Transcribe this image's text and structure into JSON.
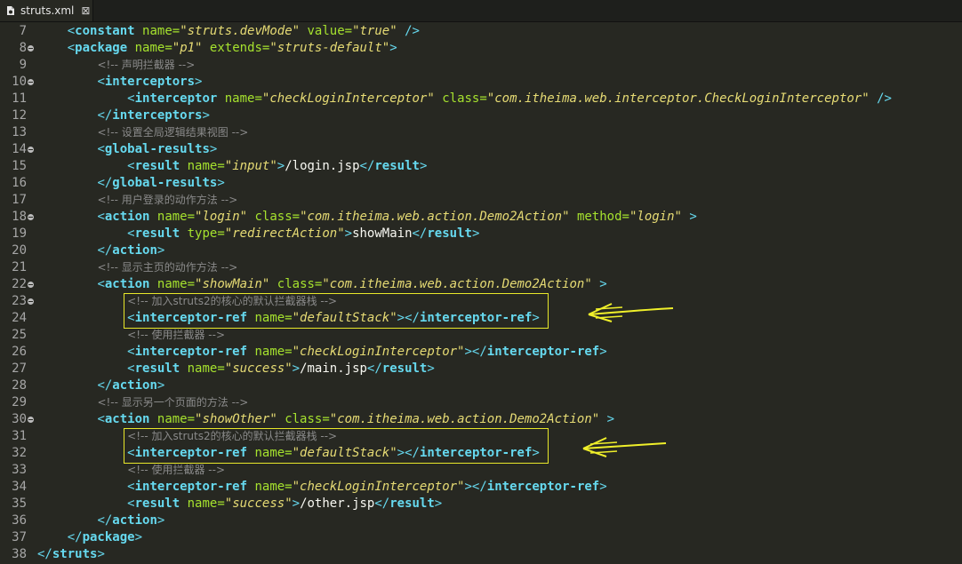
{
  "tab": {
    "title": "struts.xml",
    "close_glyph": "⊠"
  },
  "lines": [
    {
      "num": "7",
      "fold": false,
      "indent": 1,
      "tokens": [
        [
          "b",
          "<"
        ],
        [
          "t",
          "constant"
        ],
        [
          "x",
          " "
        ],
        [
          "a",
          "name="
        ],
        [
          "v",
          "\"struts.devMode\""
        ],
        [
          "x",
          " "
        ],
        [
          "a",
          "value="
        ],
        [
          "v",
          "\"true\""
        ],
        [
          "x",
          " "
        ],
        [
          "b",
          "/>"
        ]
      ]
    },
    {
      "num": "8",
      "fold": true,
      "indent": 1,
      "tokens": [
        [
          "b",
          "<"
        ],
        [
          "t",
          "package"
        ],
        [
          "x",
          " "
        ],
        [
          "a",
          "name="
        ],
        [
          "v",
          "\"p1\""
        ],
        [
          "x",
          " "
        ],
        [
          "a",
          "extends="
        ],
        [
          "v",
          "\"struts-default\""
        ],
        [
          "b",
          ">"
        ]
      ]
    },
    {
      "num": "9",
      "fold": false,
      "indent": 2,
      "tokens": [
        [
          "c",
          "<!-- 声明拦截器 -->"
        ]
      ]
    },
    {
      "num": "10",
      "fold": true,
      "indent": 2,
      "tokens": [
        [
          "b",
          "<"
        ],
        [
          "t",
          "interceptors"
        ],
        [
          "b",
          ">"
        ]
      ]
    },
    {
      "num": "11",
      "fold": false,
      "indent": 3,
      "tokens": [
        [
          "b",
          "<"
        ],
        [
          "t",
          "interceptor"
        ],
        [
          "x",
          " "
        ],
        [
          "a",
          "name="
        ],
        [
          "v",
          "\"checkLoginInterceptor\""
        ],
        [
          "x",
          " "
        ],
        [
          "a",
          "class="
        ],
        [
          "v",
          "\"com.itheima.web.interceptor.CheckLoginInterceptor\""
        ],
        [
          "x",
          " "
        ],
        [
          "b",
          "/>"
        ]
      ]
    },
    {
      "num": "12",
      "fold": false,
      "indent": 2,
      "tokens": [
        [
          "b",
          "</"
        ],
        [
          "t",
          "interceptors"
        ],
        [
          "b",
          ">"
        ]
      ]
    },
    {
      "num": "13",
      "fold": false,
      "indent": 2,
      "tokens": [
        [
          "c",
          "<!-- 设置全局逻辑结果视图 -->"
        ]
      ]
    },
    {
      "num": "14",
      "fold": true,
      "indent": 2,
      "tokens": [
        [
          "b",
          "<"
        ],
        [
          "t",
          "global-results"
        ],
        [
          "b",
          ">"
        ]
      ]
    },
    {
      "num": "15",
      "fold": false,
      "indent": 3,
      "tokens": [
        [
          "b",
          "<"
        ],
        [
          "t",
          "result"
        ],
        [
          "x",
          " "
        ],
        [
          "a",
          "name="
        ],
        [
          "v",
          "\"input\""
        ],
        [
          "b",
          ">"
        ],
        [
          "x",
          "/login.jsp"
        ],
        [
          "b",
          "</"
        ],
        [
          "t",
          "result"
        ],
        [
          "b",
          ">"
        ]
      ]
    },
    {
      "num": "16",
      "fold": false,
      "indent": 2,
      "tokens": [
        [
          "b",
          "</"
        ],
        [
          "t",
          "global-results"
        ],
        [
          "b",
          ">"
        ]
      ]
    },
    {
      "num": "17",
      "fold": false,
      "indent": 2,
      "tokens": [
        [
          "c",
          "<!-- 用户登录的动作方法 -->"
        ]
      ]
    },
    {
      "num": "18",
      "fold": true,
      "indent": 2,
      "tokens": [
        [
          "b",
          "<"
        ],
        [
          "t",
          "action"
        ],
        [
          "x",
          " "
        ],
        [
          "a",
          "name="
        ],
        [
          "v",
          "\"login\""
        ],
        [
          "x",
          " "
        ],
        [
          "a",
          "class="
        ],
        [
          "v",
          "\"com.itheima.web.action.Demo2Action\""
        ],
        [
          "x",
          " "
        ],
        [
          "a",
          "method="
        ],
        [
          "v",
          "\"login\""
        ],
        [
          "x",
          " "
        ],
        [
          "b",
          ">"
        ]
      ]
    },
    {
      "num": "19",
      "fold": false,
      "indent": 3,
      "tokens": [
        [
          "b",
          "<"
        ],
        [
          "t",
          "result"
        ],
        [
          "x",
          " "
        ],
        [
          "a",
          "type="
        ],
        [
          "v",
          "\"redirectAction\""
        ],
        [
          "b",
          ">"
        ],
        [
          "x",
          "showMain"
        ],
        [
          "b",
          "</"
        ],
        [
          "t",
          "result"
        ],
        [
          "b",
          ">"
        ]
      ]
    },
    {
      "num": "20",
      "fold": false,
      "indent": 2,
      "tokens": [
        [
          "b",
          "</"
        ],
        [
          "t",
          "action"
        ],
        [
          "b",
          ">"
        ]
      ]
    },
    {
      "num": "21",
      "fold": false,
      "indent": 2,
      "tokens": [
        [
          "c",
          "<!-- 显示主页的动作方法 -->"
        ]
      ]
    },
    {
      "num": "22",
      "fold": true,
      "indent": 2,
      "tokens": [
        [
          "b",
          "<"
        ],
        [
          "t",
          "action"
        ],
        [
          "x",
          " "
        ],
        [
          "a",
          "name="
        ],
        [
          "v",
          "\"showMain\""
        ],
        [
          "x",
          " "
        ],
        [
          "a",
          "class="
        ],
        [
          "v",
          "\"com.itheima.web.action.Demo2Action\""
        ],
        [
          "x",
          " "
        ],
        [
          "b",
          ">"
        ]
      ]
    },
    {
      "num": "23",
      "fold": true,
      "indent": 3,
      "tokens": [
        [
          "c",
          "<!-- 加入struts2的核心的默认拦截器栈 -->"
        ]
      ]
    },
    {
      "num": "24",
      "fold": false,
      "indent": 3,
      "tokens": [
        [
          "b",
          "<"
        ],
        [
          "t",
          "interceptor-ref"
        ],
        [
          "x",
          " "
        ],
        [
          "a",
          "name="
        ],
        [
          "v",
          "\"defaultStack\""
        ],
        [
          "b",
          "></"
        ],
        [
          "t",
          "interceptor-ref"
        ],
        [
          "b",
          ">"
        ]
      ]
    },
    {
      "num": "25",
      "fold": false,
      "indent": 3,
      "tokens": [
        [
          "c",
          "<!-- 使用拦截器 -->"
        ]
      ]
    },
    {
      "num": "26",
      "fold": false,
      "indent": 3,
      "tokens": [
        [
          "b",
          "<"
        ],
        [
          "t",
          "interceptor-ref"
        ],
        [
          "x",
          " "
        ],
        [
          "a",
          "name="
        ],
        [
          "v",
          "\"checkLoginInterceptor\""
        ],
        [
          "b",
          "></"
        ],
        [
          "t",
          "interceptor-ref"
        ],
        [
          "b",
          ">"
        ]
      ]
    },
    {
      "num": "27",
      "fold": false,
      "indent": 3,
      "tokens": [
        [
          "b",
          "<"
        ],
        [
          "t",
          "result"
        ],
        [
          "x",
          " "
        ],
        [
          "a",
          "name="
        ],
        [
          "v",
          "\"success\""
        ],
        [
          "b",
          ">"
        ],
        [
          "x",
          "/main.jsp"
        ],
        [
          "b",
          "</"
        ],
        [
          "t",
          "result"
        ],
        [
          "b",
          ">"
        ]
      ]
    },
    {
      "num": "28",
      "fold": false,
      "indent": 2,
      "tokens": [
        [
          "b",
          "</"
        ],
        [
          "t",
          "action"
        ],
        [
          "b",
          ">"
        ]
      ]
    },
    {
      "num": "29",
      "fold": false,
      "indent": 2,
      "tokens": [
        [
          "c",
          "<!-- 显示另一个页面的方法 -->"
        ]
      ]
    },
    {
      "num": "30",
      "fold": true,
      "indent": 2,
      "tokens": [
        [
          "b",
          "<"
        ],
        [
          "t",
          "action"
        ],
        [
          "x",
          " "
        ],
        [
          "a",
          "name="
        ],
        [
          "v",
          "\"showOther\""
        ],
        [
          "x",
          " "
        ],
        [
          "a",
          "class="
        ],
        [
          "v",
          "\"com.itheima.web.action.Demo2Action\""
        ],
        [
          "x",
          " "
        ],
        [
          "b",
          ">"
        ]
      ]
    },
    {
      "num": "31",
      "fold": false,
      "indent": 3,
      "tokens": [
        [
          "c",
          "<!-- 加入struts2的核心的默认拦截器栈 -->"
        ]
      ]
    },
    {
      "num": "32",
      "fold": false,
      "indent": 3,
      "tokens": [
        [
          "b",
          "<"
        ],
        [
          "t",
          "interceptor-ref"
        ],
        [
          "x",
          " "
        ],
        [
          "a",
          "name="
        ],
        [
          "v",
          "\"defaultStack\""
        ],
        [
          "b",
          "></"
        ],
        [
          "t",
          "interceptor-ref"
        ],
        [
          "b",
          ">"
        ]
      ]
    },
    {
      "num": "33",
      "fold": false,
      "indent": 3,
      "tokens": [
        [
          "c",
          "<!-- 使用拦截器 -->"
        ]
      ]
    },
    {
      "num": "34",
      "fold": false,
      "indent": 3,
      "tokens": [
        [
          "b",
          "<"
        ],
        [
          "t",
          "interceptor-ref"
        ],
        [
          "x",
          " "
        ],
        [
          "a",
          "name="
        ],
        [
          "v",
          "\"checkLoginInterceptor\""
        ],
        [
          "b",
          "></"
        ],
        [
          "t",
          "interceptor-ref"
        ],
        [
          "b",
          ">"
        ]
      ]
    },
    {
      "num": "35",
      "fold": false,
      "indent": 3,
      "tokens": [
        [
          "b",
          "<"
        ],
        [
          "t",
          "result"
        ],
        [
          "x",
          " "
        ],
        [
          "a",
          "name="
        ],
        [
          "v",
          "\"success\""
        ],
        [
          "b",
          ">"
        ],
        [
          "x",
          "/other.jsp"
        ],
        [
          "b",
          "</"
        ],
        [
          "t",
          "result"
        ],
        [
          "b",
          ">"
        ]
      ]
    },
    {
      "num": "36",
      "fold": false,
      "indent": 2,
      "tokens": [
        [
          "b",
          "</"
        ],
        [
          "t",
          "action"
        ],
        [
          "b",
          ">"
        ]
      ]
    },
    {
      "num": "37",
      "fold": false,
      "indent": 1,
      "tokens": [
        [
          "b",
          "</"
        ],
        [
          "t",
          "package"
        ],
        [
          "b",
          ">"
        ]
      ]
    },
    {
      "num": "38",
      "fold": false,
      "indent": 0,
      "tokens": [
        [
          "b",
          "</"
        ],
        [
          "t",
          "struts"
        ],
        [
          "b",
          ">"
        ]
      ]
    }
  ],
  "highlights": [
    {
      "lines": [
        "23",
        "24"
      ]
    },
    {
      "lines": [
        "31",
        "32"
      ]
    }
  ],
  "colors": {
    "background": "#272822",
    "tag": "#66d9ef",
    "attribute": "#a6e22e",
    "value": "#e6db74",
    "comment": "#8a8a8a",
    "highlight": "#e8e82a"
  }
}
